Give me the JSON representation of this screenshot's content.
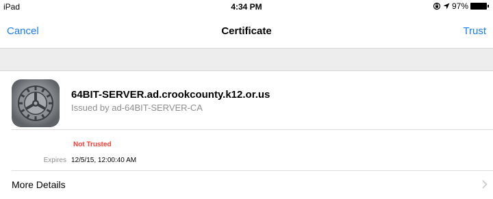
{
  "status_bar": {
    "device": "iPad",
    "time": "4:34 PM",
    "battery_percent": "97%",
    "battery_level": 0.97
  },
  "navbar": {
    "cancel_label": "Cancel",
    "title": "Certificate",
    "trust_label": "Trust"
  },
  "certificate": {
    "name": "64BIT-SERVER.ad.crookcounty.k12.or.us",
    "issued_by": "Issued by ad-64BIT-SERVER-CA",
    "status": "Not Trusted",
    "expires_label": "Expires",
    "expires_value": "12/5/15, 12:00:40 AM"
  },
  "more_details_label": "More Details",
  "colors": {
    "accent": "#1a7cf7",
    "warning": "#ff3b30",
    "secondary_text": "#8e8e8e"
  },
  "icons": [
    "lock-rotation-icon",
    "location-arrow-icon",
    "battery-icon",
    "settings-gear-icon",
    "chevron-right-icon"
  ]
}
